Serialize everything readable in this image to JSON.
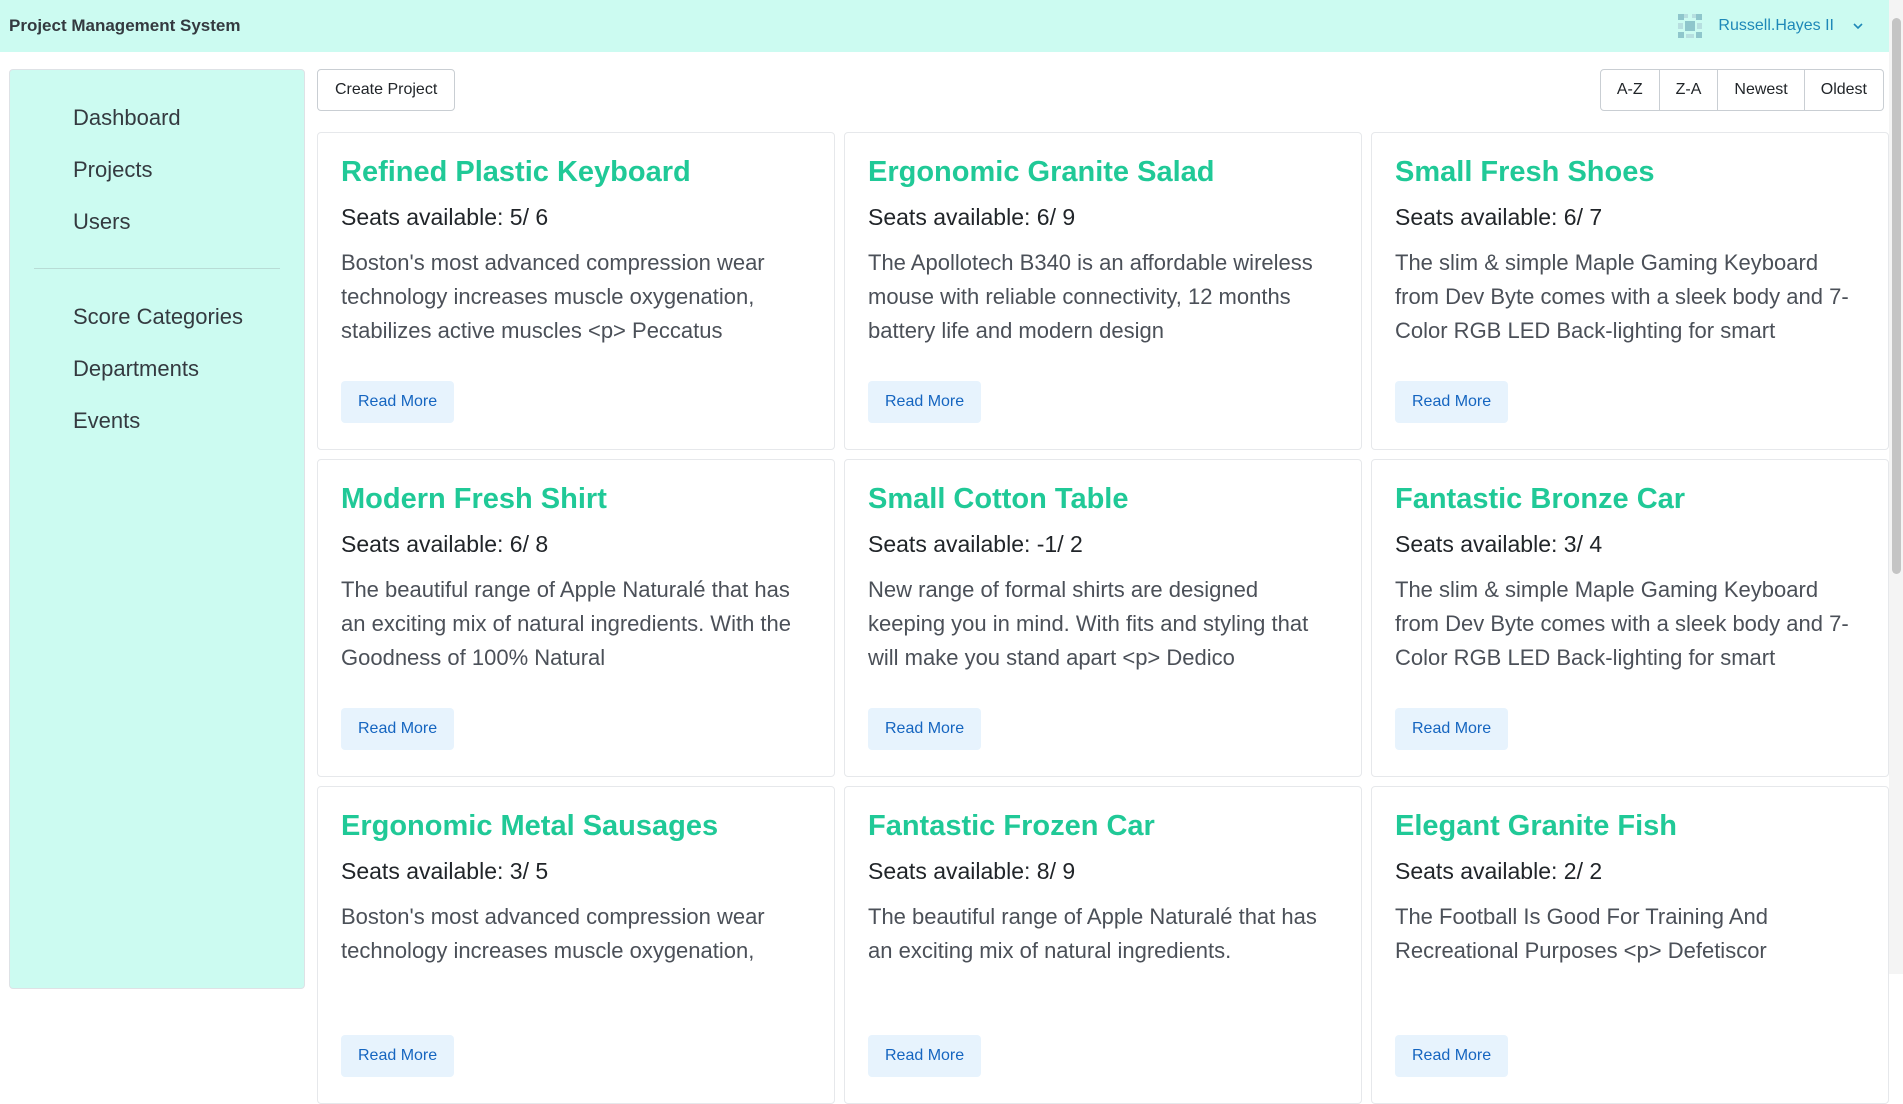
{
  "header": {
    "title": "Project Management System",
    "user_name": "Russell.Hayes II",
    "avatar_icon": "identicon-avatar",
    "chevron_icon": "chevron-down-icon",
    "bg_color": "#ccfbf1"
  },
  "sidebar": {
    "group1": [
      {
        "label": "Dashboard"
      },
      {
        "label": "Projects"
      },
      {
        "label": "Users"
      }
    ],
    "group2": [
      {
        "label": "Score Categories"
      },
      {
        "label": "Departments"
      },
      {
        "label": "Events"
      }
    ]
  },
  "toolbar": {
    "create_label": "Create Project",
    "sort": [
      "A-Z",
      "Z-A",
      "Newest",
      "Oldest"
    ]
  },
  "cards": [
    {
      "title": "Refined Plastic Keyboard",
      "seats": "Seats available: 5/ 6",
      "desc": "Boston's most advanced compression wear technology increases muscle oxygenation, stabilizes active muscles <p> Peccatus",
      "button": "Read More"
    },
    {
      "title": "Ergonomic Granite Salad",
      "seats": "Seats available: 6/ 9",
      "desc": "The Apollotech B340 is an affordable wireless mouse with reliable connectivity, 12 months battery life and modern design",
      "button": "Read More"
    },
    {
      "title": "Small Fresh Shoes",
      "seats": "Seats available: 6/ 7",
      "desc": "The slim & simple Maple Gaming Keyboard from Dev Byte comes with a sleek body and 7- Color RGB LED Back-lighting for smart",
      "button": "Read More"
    },
    {
      "title": "Modern Fresh Shirt",
      "seats": "Seats available: 6/ 8",
      "desc": "The beautiful range of Apple Naturalé that has an exciting mix of natural ingredients. With the Goodness of 100% Natural",
      "button": "Read More"
    },
    {
      "title": "Small Cotton Table",
      "seats": "Seats available: -1/ 2",
      "desc": "New range of formal shirts are designed keeping you in mind. With fits and styling that will make you stand apart <p> Dedico",
      "button": "Read More"
    },
    {
      "title": "Fantastic Bronze Car",
      "seats": "Seats available: 3/ 4",
      "desc": "The slim & simple Maple Gaming Keyboard from Dev Byte comes with a sleek body and 7- Color RGB LED Back-lighting for smart",
      "button": "Read More"
    },
    {
      "title": "Ergonomic Metal Sausages",
      "seats": "Seats available: 3/ 5",
      "desc": "Boston's most advanced compression wear technology increases muscle oxygenation,",
      "button": "Read More"
    },
    {
      "title": "Fantastic Frozen Car",
      "seats": "Seats available: 8/ 9",
      "desc": "The beautiful range of Apple Naturalé that has an exciting mix of natural ingredients.",
      "button": "Read More"
    },
    {
      "title": "Elegant Granite Fish",
      "seats": "Seats available: 2/ 2",
      "desc": "The Football Is Good For Training And Recreational Purposes <p> Defetiscor",
      "button": "Read More"
    }
  ],
  "colors": {
    "accent": "#20c997",
    "sidebar_bg": "#ccfbf1",
    "link_blue": "#1565c0"
  }
}
